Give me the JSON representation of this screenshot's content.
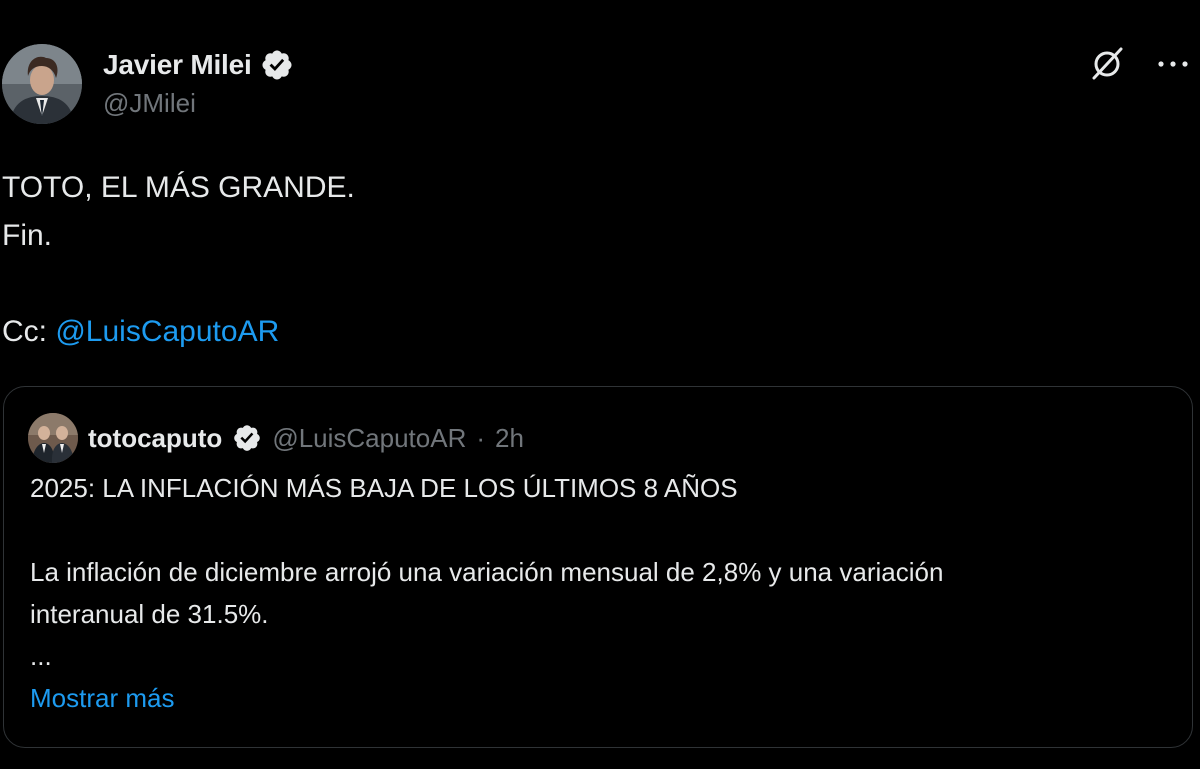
{
  "author": {
    "display_name": "Javier Milei",
    "handle": "@JMilei",
    "verified": true,
    "avatar_icon": "avatar-photo-icon"
  },
  "actions": {
    "grok_icon": "grok-icon",
    "more_icon": "more-options-icon",
    "more_label": "···"
  },
  "tweet": {
    "line1": "TOTO, EL MÁS GRANDE.",
    "line2": "Fin.",
    "cc_prefix": "Cc: ",
    "mention": "@LuisCaputoAR"
  },
  "quote": {
    "display_name": "totocaputo",
    "handle": "@LuisCaputoAR",
    "separator": "·",
    "time": "2h",
    "verified": true,
    "headline": "2025: LA INFLACIÓN MÁS BAJA DE LOS ÚLTIMOS 8 AÑOS",
    "body_line1": "La inflación de diciembre arrojó una variación mensual de 2,8% y una variación",
    "body_line2": "interanual de 31.5%.",
    "ellipsis": "...",
    "show_more": "Mostrar más"
  },
  "colors": {
    "background": "#000000",
    "text": "#e7e9ea",
    "secondary": "#71767b",
    "link": "#1d9bf0",
    "border": "#2f3336"
  }
}
